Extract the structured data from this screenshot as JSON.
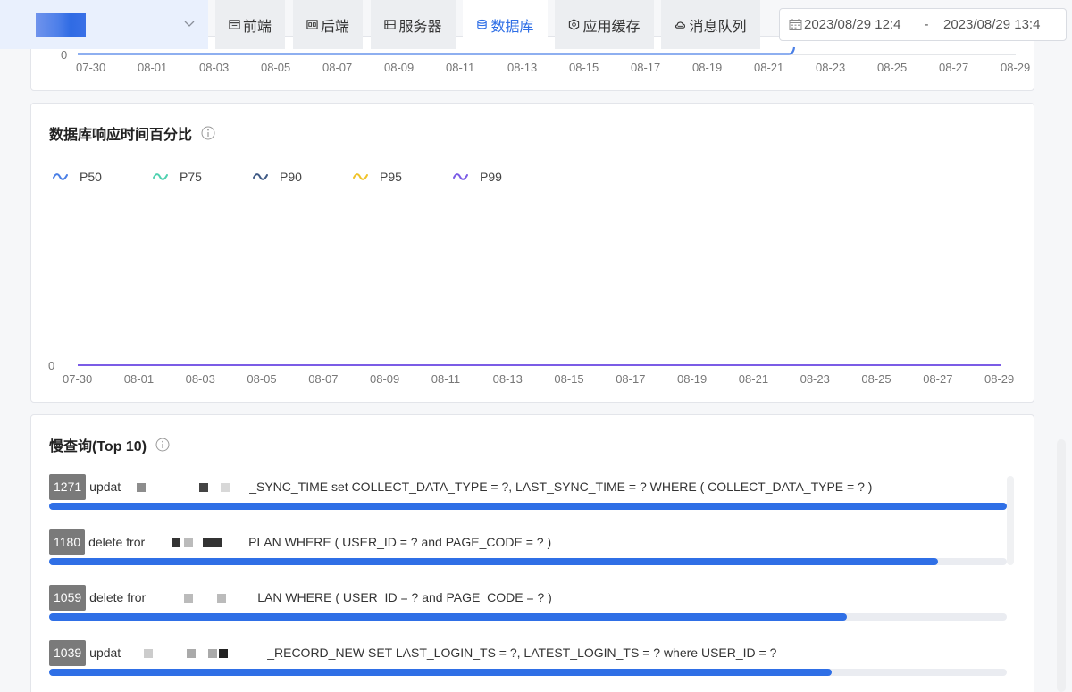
{
  "header": {
    "tabs": [
      {
        "label": "前端",
        "icon": "frontend-icon"
      },
      {
        "label": "后端",
        "icon": "backend-icon"
      },
      {
        "label": "服务器",
        "icon": "server-icon"
      },
      {
        "label": "数据库",
        "icon": "database-icon",
        "active": true
      },
      {
        "label": "应用缓存",
        "icon": "cache-icon"
      },
      {
        "label": "消息队列",
        "icon": "cloud-icon"
      }
    ],
    "date_range": {
      "start": "2023/08/29 12:4",
      "separator": "-",
      "end": "2023/08/29 13:4"
    }
  },
  "top_chart": {
    "y_zero": "0",
    "x_ticks": [
      "07-30",
      "08-01",
      "08-03",
      "08-05",
      "08-07",
      "08-09",
      "08-11",
      "08-13",
      "08-15",
      "08-17",
      "08-19",
      "08-21",
      "08-23",
      "08-25",
      "08-27",
      "08-29"
    ]
  },
  "db_chart": {
    "title": "数据库响应时间百分比",
    "y_zero": "0",
    "legend": [
      {
        "name": "P50",
        "color": "#4a7fe6"
      },
      {
        "name": "P75",
        "color": "#4fd1b0"
      },
      {
        "name": "P90",
        "color": "#3f5a85"
      },
      {
        "name": "P95",
        "color": "#f0c32a"
      },
      {
        "name": "P99",
        "color": "#7b5ce6"
      }
    ],
    "x_ticks": [
      "07-30",
      "08-01",
      "08-03",
      "08-05",
      "08-07",
      "08-09",
      "08-11",
      "08-13",
      "08-15",
      "08-17",
      "08-19",
      "08-21",
      "08-23",
      "08-25",
      "08-27",
      "08-29"
    ]
  },
  "chart_data": {
    "type": "line",
    "title": "数据库响应时间百分比",
    "categories": [
      "07-30",
      "08-01",
      "08-03",
      "08-05",
      "08-07",
      "08-09",
      "08-11",
      "08-13",
      "08-15",
      "08-17",
      "08-19",
      "08-21",
      "08-23",
      "08-25",
      "08-27",
      "08-29"
    ],
    "series": [
      {
        "name": "P50",
        "values": [
          0,
          0,
          0,
          0,
          0,
          0,
          0,
          0,
          0,
          0,
          0,
          0,
          0,
          0,
          0,
          0
        ]
      },
      {
        "name": "P75",
        "values": [
          0,
          0,
          0,
          0,
          0,
          0,
          0,
          0,
          0,
          0,
          0,
          0,
          0,
          0,
          0,
          0
        ]
      },
      {
        "name": "P90",
        "values": [
          0,
          0,
          0,
          0,
          0,
          0,
          0,
          0,
          0,
          0,
          0,
          0,
          0,
          0,
          0,
          0
        ]
      },
      {
        "name": "P95",
        "values": [
          0,
          0,
          0,
          0,
          0,
          0,
          0,
          0,
          0,
          0,
          0,
          0,
          0,
          0,
          0,
          0
        ]
      },
      {
        "name": "P99",
        "values": [
          0,
          0,
          0,
          0,
          0,
          0,
          0,
          0,
          0,
          0,
          0,
          0,
          0,
          0,
          0,
          0
        ]
      }
    ],
    "legend": "top-left"
  },
  "slow_queries": {
    "title": "慢查询(Top 10)",
    "items": [
      {
        "count": "1271",
        "prefix": "updat",
        "text": "_SYNC_TIME set COLLECT_DATA_TYPE = ?, LAST_SYNC_TIME = ? WHERE ( COLLECT_DATA_TYPE = ? )",
        "fraction": 1.0
      },
      {
        "count": "1180",
        "prefix": "delete fror",
        "text": "PLAN WHERE ( USER_ID = ? and PAGE_CODE = ? )",
        "fraction": 0.928
      },
      {
        "count": "1059",
        "prefix": "delete fror",
        "text": "LAN WHERE ( USER_ID = ? and PAGE_CODE = ? )",
        "fraction": 0.833
      },
      {
        "count": "1039",
        "prefix": "updat",
        "text": "_RECORD_NEW SET LAST_LOGIN_TS = ?, LATEST_LOGIN_TS = ? where USER_ID = ?",
        "fraction": 0.817
      }
    ]
  }
}
